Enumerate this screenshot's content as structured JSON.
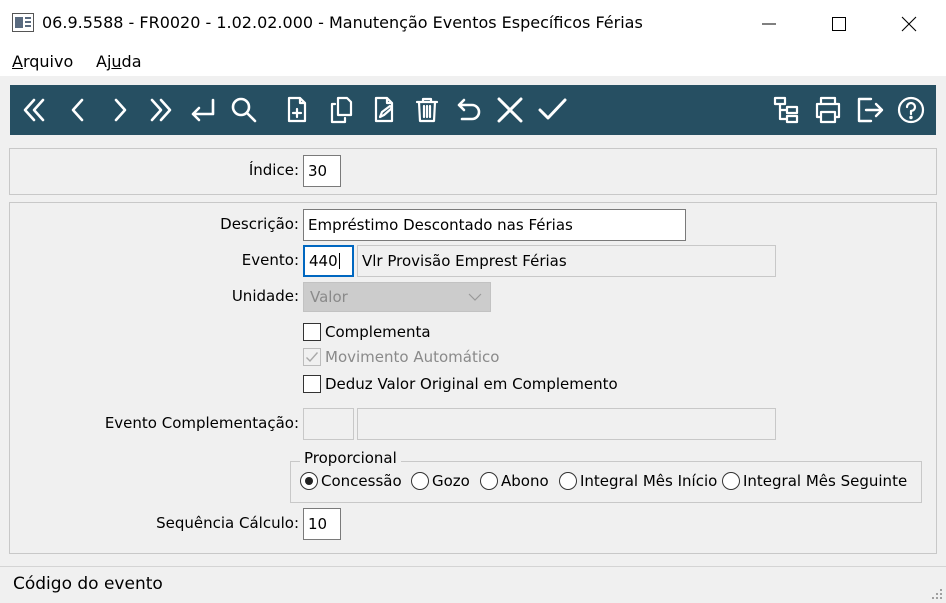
{
  "window": {
    "title": "06.9.5588 - FR0020 - 1.02.02.000 - Manutenção Eventos Específicos Férias",
    "icon": "app-window-icon"
  },
  "menu": {
    "arquivo_first": "A",
    "arquivo_rest": "rquivo",
    "ajuda_first": "Aj",
    "ajuda_u": "u",
    "ajuda_rest": "da"
  },
  "toolbar": {
    "background": "#264f62",
    "left_icons": [
      "first-record-icon",
      "previous-record-icon",
      "next-record-icon",
      "last-record-icon",
      "goto-icon",
      "search-icon",
      "new-document-icon",
      "copy-document-icon",
      "edit-document-icon",
      "delete-icon",
      "undo-icon",
      "cancel-icon",
      "confirm-icon"
    ],
    "right_icons": [
      "tree-icon",
      "print-icon",
      "exit-icon",
      "help-icon"
    ]
  },
  "form": {
    "indice": {
      "label": "Índice:",
      "value": "30"
    },
    "descricao": {
      "label": "Descrição:",
      "value": "Empréstimo Descontado nas Férias"
    },
    "evento": {
      "label": "Evento:",
      "code": "440",
      "description": "Vlr Provisão Emprest Férias"
    },
    "unidade": {
      "label": "Unidade:",
      "value": "Valor"
    },
    "complementa": {
      "label": "Complementa",
      "checked": false
    },
    "movimento_automatico": {
      "label": "Movimento Automático",
      "checked": true,
      "disabled": true
    },
    "deduz_valor": {
      "label": "Deduz Valor Original em Complemento",
      "checked": false
    },
    "evento_complementacao": {
      "label": "Evento Complementação:",
      "code": "",
      "description": ""
    },
    "proporcional": {
      "legend": "Proporcional",
      "options": [
        "Concessão",
        "Gozo",
        "Abono",
        "Integral Mês Início",
        "Integral Mês Seguinte"
      ],
      "selected": "Concessão"
    },
    "sequencia_calculo": {
      "label": "Sequência Cálculo:",
      "value": "10"
    }
  },
  "status": {
    "text": "Código do evento"
  }
}
